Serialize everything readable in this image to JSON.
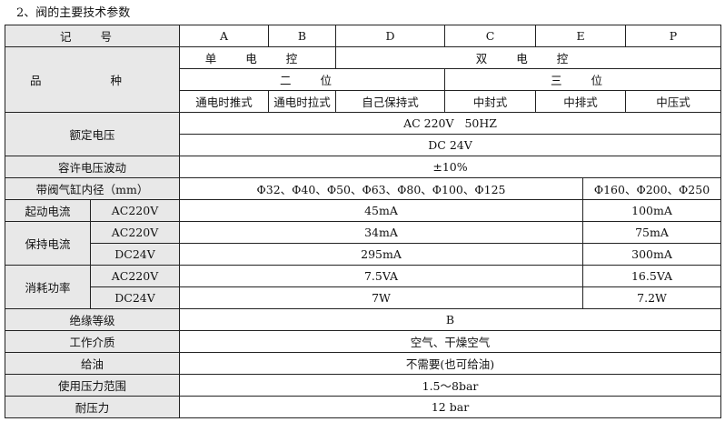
{
  "heading": "2、阀的主要技术参数",
  "rows": {
    "code": {
      "label": "记 号",
      "A": "A",
      "B": "B",
      "D": "D",
      "C": "C",
      "E": "E",
      "P": "P"
    },
    "variety": {
      "label": "品 种",
      "single": "单 电 控",
      "double": "双 电 控",
      "two_pos": "二 位",
      "three_pos": "三 位",
      "types": [
        "通电时推式",
        "通电时拉式",
        "自己保持式",
        "中封式",
        "中排式",
        "中压式"
      ]
    },
    "rated_voltage": {
      "label": "额定电压",
      "ac": "AC 220V   50HZ",
      "dc": "DC 24V"
    },
    "tolerance": {
      "label": "容许电压波动",
      "value": "±10%"
    },
    "bore": {
      "label": "带阀气缸内径（mm）",
      "left": "Φ32、Φ40、Φ50、Φ63、Φ80、Φ100、Φ125",
      "right": "Φ160、Φ200、Φ250"
    },
    "start_current": {
      "label": "起动电流",
      "sub": "AC220V",
      "left": "45mA",
      "right": "100mA"
    },
    "hold_current": {
      "label": "保持电流",
      "ac_sub": "AC220V",
      "ac_left": "34mA",
      "ac_right": "75mA",
      "dc_sub": "DC24V",
      "dc_left": "295mA",
      "dc_right": "300mA"
    },
    "power": {
      "label": "消耗功率",
      "ac_sub": "AC220V",
      "ac_left": "7.5VA",
      "ac_right": "16.5VA",
      "dc_sub": "DC24V",
      "dc_left": "7W",
      "dc_right": "7.2W"
    },
    "insulation": {
      "label": "绝缘等级",
      "value": "B"
    },
    "medium": {
      "label": "工作介质",
      "value": "空气、干燥空气"
    },
    "oiling": {
      "label": "给油",
      "value": "不需要(也可给油)"
    },
    "pressure_range": {
      "label": "使用压力范围",
      "value": "1.5～8bar"
    },
    "proof_pressure": {
      "label": "耐压力",
      "value": "12 bar"
    }
  }
}
